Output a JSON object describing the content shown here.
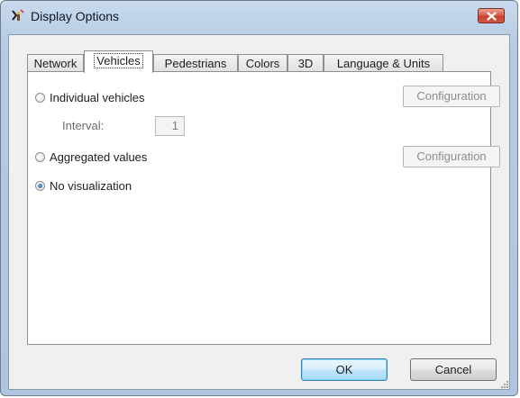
{
  "window": {
    "title": "Display Options",
    "icon": "display-options-app-icon",
    "close_icon": "close-icon"
  },
  "tabs": [
    {
      "label": "Network",
      "active": false
    },
    {
      "label": "Vehicles",
      "active": true
    },
    {
      "label": "Pedestrians",
      "active": false
    },
    {
      "label": "Colors",
      "active": false
    },
    {
      "label": "3D",
      "active": false
    },
    {
      "label": "Language & Units",
      "active": false
    }
  ],
  "vehicles": {
    "options": [
      {
        "label": "Individual vehicles",
        "checked": false,
        "config_label": "Configuration",
        "config_enabled": false
      },
      {
        "label": "Aggregated values",
        "checked": false,
        "config_label": "Configuration",
        "config_enabled": false
      },
      {
        "label": "No visualization",
        "checked": true
      }
    ],
    "interval": {
      "label": "Interval:",
      "value": "1",
      "enabled": false
    }
  },
  "buttons": {
    "ok": "OK",
    "cancel": "Cancel"
  },
  "colors": {
    "close_red": "#c5412d",
    "default_button_border": "#3c7fb1",
    "radio_dot": "#1c5fa8"
  }
}
